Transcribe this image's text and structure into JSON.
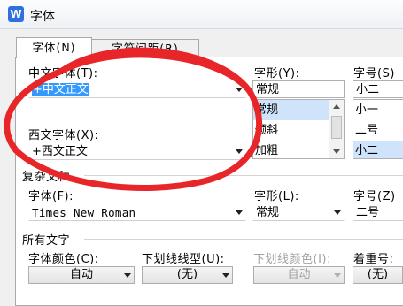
{
  "window": {
    "title": "字体",
    "logo_text": "W"
  },
  "tabs": [
    {
      "label": "字体(N)"
    },
    {
      "label": "字符间距(R)"
    }
  ],
  "chinese_font": {
    "label": "中文字体(T):",
    "value": "+中文正文"
  },
  "western_font": {
    "label": "西文字体(X):",
    "value": "+西文正文"
  },
  "style": {
    "label": "字形(Y):",
    "value": "常规",
    "options": [
      "常规",
      "倾斜",
      "加粗"
    ],
    "selected": "常规"
  },
  "size": {
    "label": "字号(S)",
    "value": "小二",
    "options": [
      "小一",
      "二号",
      "小二"
    ],
    "selected": "小二"
  },
  "complex": {
    "section_label": "复杂文种",
    "font_label": "字体(F):",
    "font_value": "Times New Roman",
    "style_label": "字形(L):",
    "style_value": "常规",
    "size_label": "字号(Z)",
    "size_value": "二号"
  },
  "all_text": {
    "section_label": "所有文字",
    "color_label": "字体颜色(C):",
    "color_value": "自动",
    "underline_label": "下划线线型(U):",
    "underline_value": "(无)",
    "underline_color_label": "下划线颜色(I):",
    "underline_color_value": "自动",
    "emphasis_label": "着重号:",
    "emphasis_value": "(无)"
  },
  "colors": {
    "annotation": "#e8262a",
    "selection": "#3399ff",
    "logo": "#2f6fe0"
  }
}
